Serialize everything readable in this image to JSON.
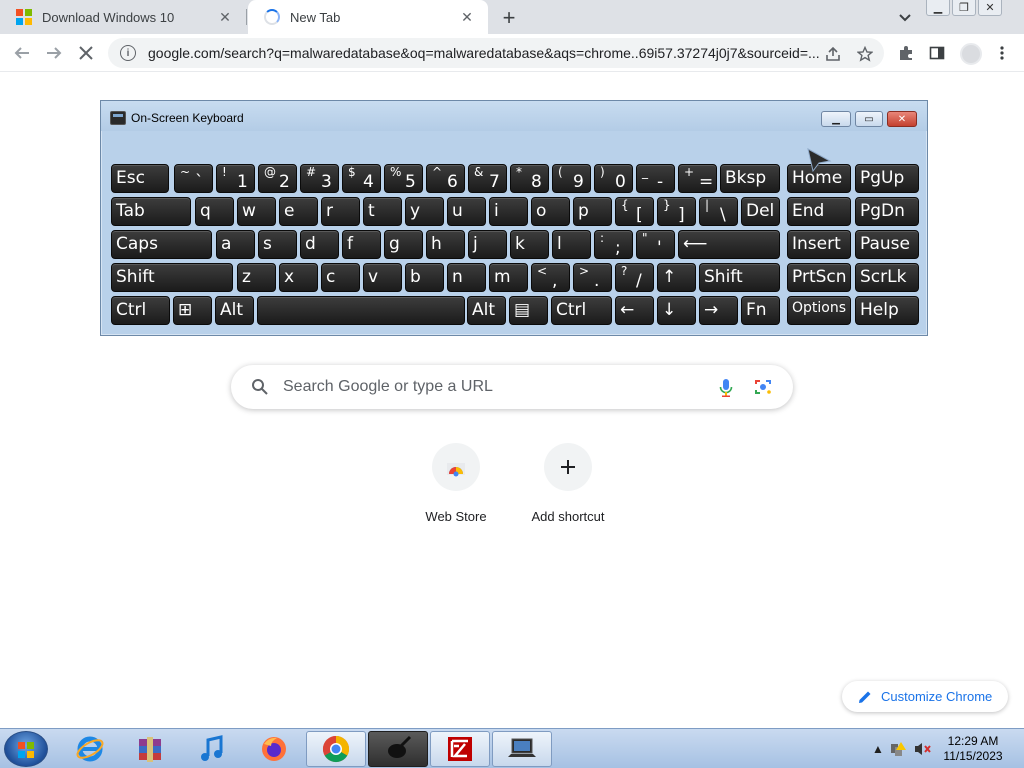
{
  "browser": {
    "tabs": [
      {
        "title": "Download Windows 10",
        "favicon": "windows-logo-icon",
        "active": false
      },
      {
        "title": "New Tab",
        "favicon": "loading-spinner-icon",
        "active": true
      }
    ],
    "new_tab_symbol": "+",
    "url": "google.com/search?q=malwaredatabase&oq=malwaredatabase&aqs=chrome..69i57.37274j0j7&sourceid=...",
    "toolbar_icons": [
      "back-arrow-icon",
      "forward-arrow-icon",
      "stop-loading-icon",
      "site-info-icon",
      "share-icon",
      "bookmark-star-icon",
      "extensions-puzzle-icon",
      "side-panel-icon",
      "profile-avatar",
      "kebab-menu-icon"
    ]
  },
  "osk": {
    "title": "On-Screen Keyboard",
    "rows": [
      [
        {
          "t": "Esc"
        },
        {
          "a": "~",
          "b": "`"
        },
        {
          "a": "!",
          "b": "1"
        },
        {
          "a": "@",
          "b": "2"
        },
        {
          "a": "#",
          "b": "3"
        },
        {
          "a": "$",
          "b": "4"
        },
        {
          "a": "%",
          "b": "5"
        },
        {
          "a": "^",
          "b": "6"
        },
        {
          "a": "&",
          "b": "7"
        },
        {
          "a": "*",
          "b": "8"
        },
        {
          "a": "(",
          "b": "9"
        },
        {
          "a": ")",
          "b": "0"
        },
        {
          "a": "_",
          "b": "-"
        },
        {
          "a": "+",
          "b": "="
        },
        {
          "t": "Bksp"
        },
        {
          "t": "Home"
        },
        {
          "t": "PgUp"
        }
      ],
      [
        {
          "t": "Tab"
        },
        {
          "t": "q"
        },
        {
          "t": "w"
        },
        {
          "t": "e"
        },
        {
          "t": "r"
        },
        {
          "t": "t"
        },
        {
          "t": "y"
        },
        {
          "t": "u"
        },
        {
          "t": "i"
        },
        {
          "t": "o"
        },
        {
          "t": "p"
        },
        {
          "a": "{",
          "b": "["
        },
        {
          "a": "}",
          "b": "]"
        },
        {
          "a": "|",
          "b": "\\"
        },
        {
          "t": "Del"
        },
        {
          "t": "End"
        },
        {
          "t": "PgDn"
        }
      ],
      [
        {
          "t": "Caps"
        },
        {
          "t": "a"
        },
        {
          "t": "s"
        },
        {
          "t": "d"
        },
        {
          "t": "f"
        },
        {
          "t": "g"
        },
        {
          "t": "h"
        },
        {
          "t": "j"
        },
        {
          "t": "k"
        },
        {
          "t": "l"
        },
        {
          "a": ":",
          "b": ";"
        },
        {
          "a": "\"",
          "b": "'"
        },
        {
          "t": "⟵"
        },
        {
          "t": "Insert"
        },
        {
          "t": "Pause"
        }
      ],
      [
        {
          "t": "Shift"
        },
        {
          "t": "z"
        },
        {
          "t": "x"
        },
        {
          "t": "c"
        },
        {
          "t": "v"
        },
        {
          "t": "b"
        },
        {
          "t": "n"
        },
        {
          "t": "m"
        },
        {
          "a": "<",
          "b": ","
        },
        {
          "a": ">",
          "b": "."
        },
        {
          "a": "?",
          "b": "/"
        },
        {
          "t": "↑"
        },
        {
          "t": "Shift"
        },
        {
          "t": "PrtScn"
        },
        {
          "t": "ScrLk"
        }
      ],
      [
        {
          "t": "Ctrl"
        },
        {
          "t": "⊞"
        },
        {
          "t": "Alt"
        },
        {
          "t": ""
        },
        {
          "t": "Alt"
        },
        {
          "t": "▤"
        },
        {
          "t": "Ctrl"
        },
        {
          "t": "←"
        },
        {
          "t": "↓"
        },
        {
          "t": "→"
        },
        {
          "t": "Fn"
        },
        {
          "t": "Options"
        },
        {
          "t": "Help"
        }
      ]
    ]
  },
  "ntp": {
    "search_placeholder": "Search Google or type a URL",
    "shortcuts": [
      {
        "label": "Web Store",
        "icon": "web-store-icon"
      },
      {
        "label": "Add shortcut",
        "icon": "plus-icon"
      }
    ],
    "customize_label": "Customize Chrome"
  },
  "taskbar": {
    "apps": [
      "internet-explorer-icon",
      "winrar-archive-icon",
      "itunes-music-icon",
      "firefox-icon",
      "chrome-icon",
      "paint-brush-icon",
      "filezilla-icon",
      "laptop-connect-icon"
    ],
    "time": "12:29 AM",
    "date": "11/15/2023"
  },
  "colors": {
    "chrome_tabstrip": "#dee1e6",
    "accent_blue": "#1a73e8",
    "osk_frame": "#b9d1ea",
    "key_face": "#262626",
    "taskbar": "#b7cdea"
  }
}
